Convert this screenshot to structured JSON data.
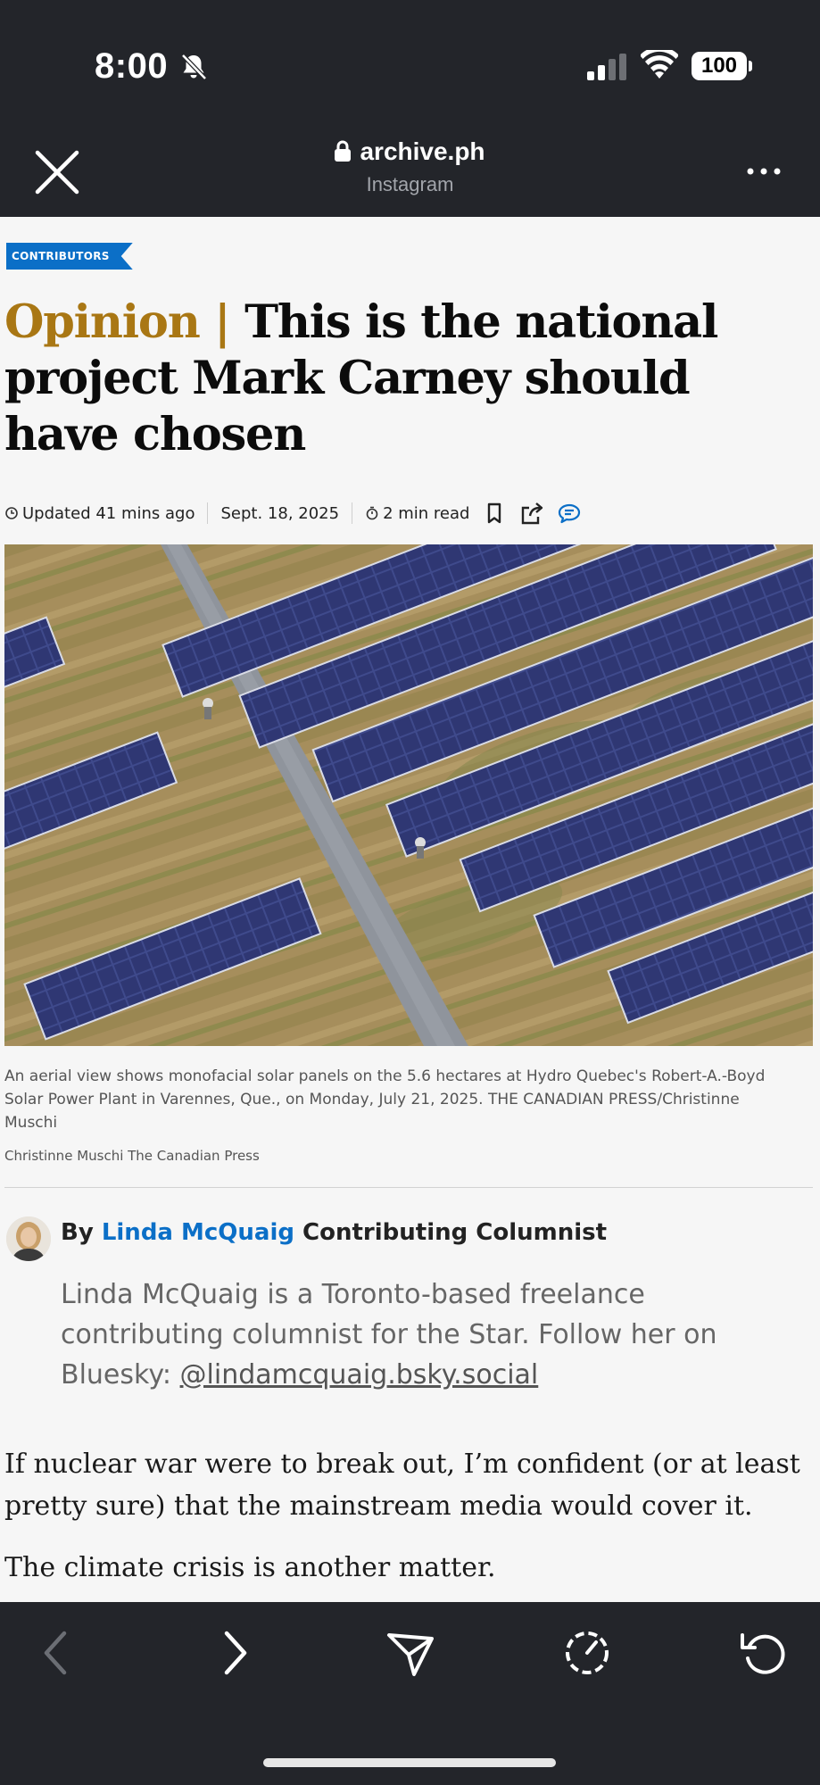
{
  "status_bar": {
    "time": "8:00",
    "battery": "100"
  },
  "browser": {
    "url": "archive.ph",
    "site_label": "Instagram"
  },
  "article": {
    "category_tag": "CONTRIBUTORS",
    "headline_prefix": "Opinion | ",
    "headline": "This is the national project Mark Carney should have chosen",
    "updated": "Updated 41 mins ago",
    "date": "Sept. 18, 2025",
    "read_time": "2 min read",
    "photo_caption": "An aerial view shows monofacial solar panels on the 5.6 hectares at Hydro Quebec's Robert-A.-Boyd Solar Power Plant in Varennes, Que., on Monday, July 21, 2025. THE CANADIAN PRESS/Christinne Muschi",
    "photo_credit": "Christinne Muschi The Canadian Press",
    "byline_prefix": "By ",
    "author_name": "Linda McQuaig",
    "author_role": " Contributing Columnist",
    "author_bio": "Linda McQuaig is a Toronto-based freelance contributing columnist for the Star. Follow her on Bluesky: ",
    "author_handle": "@lindamcquaig.bsky.social",
    "paragraphs": [
      "If nuclear war were to break out, I’m confident (or at least pretty sure) that the mainstream media would cover it.",
      "The climate crisis is another matter."
    ]
  },
  "icons": {
    "status": [
      "bell-slash-icon",
      "signal-icon",
      "wifi-icon",
      "battery-icon"
    ],
    "header": [
      "close-icon",
      "lock-icon",
      "more-icon"
    ],
    "meta": [
      "clock-icon",
      "timer-icon",
      "bookmark-icon",
      "share-icon",
      "comment-icon"
    ],
    "toolbar": [
      "back-icon",
      "forward-icon",
      "send-icon",
      "speed-icon",
      "reload-icon"
    ]
  },
  "colors": {
    "chrome": "#23252a",
    "page": "#f6f6f6",
    "accent": "#0b6fc7",
    "opinion": "#a97714"
  }
}
